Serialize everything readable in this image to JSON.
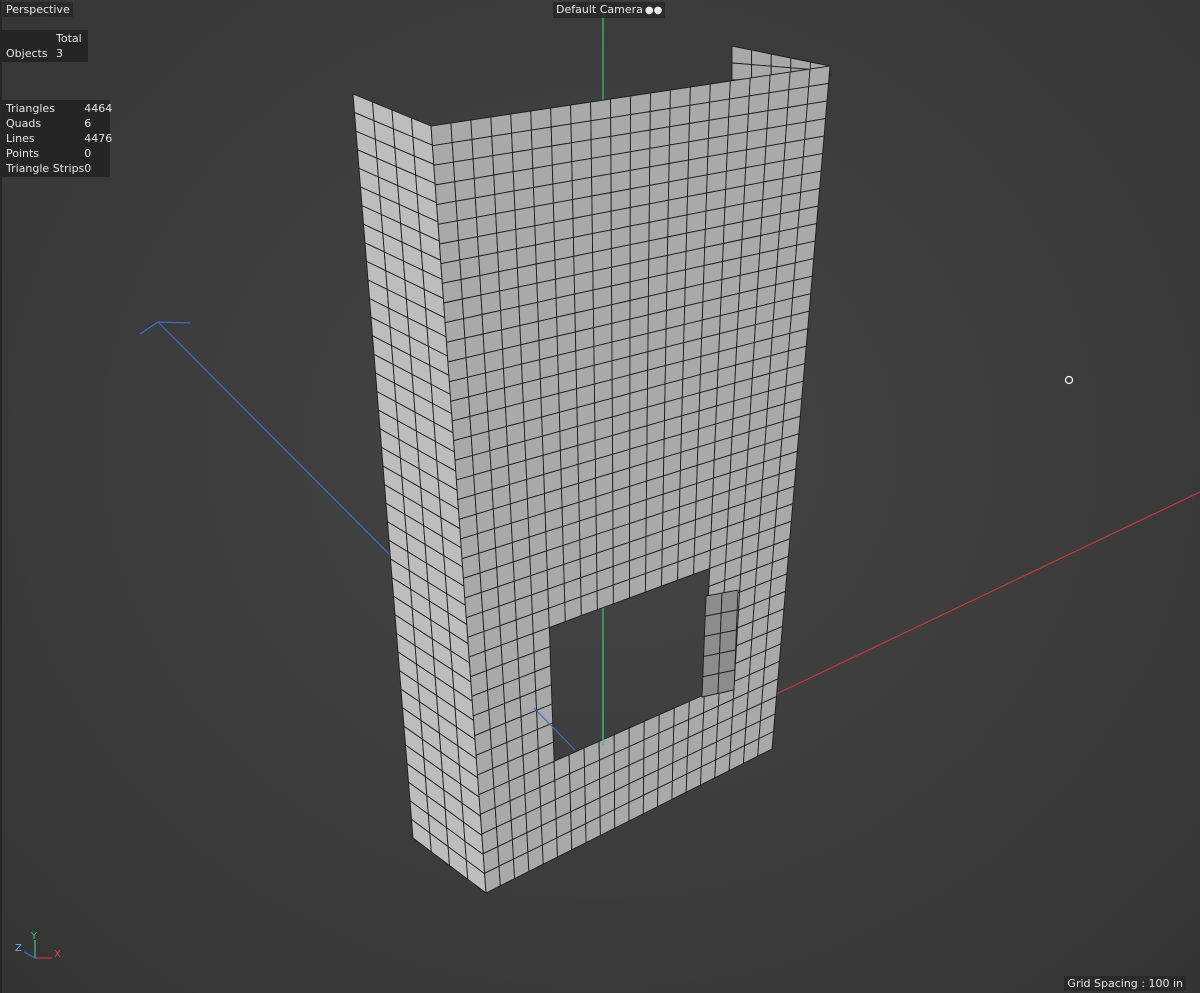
{
  "viewport": {
    "view_name": "Perspective",
    "camera_name": "Default Camera",
    "camera_icon": "camera-icon",
    "grid_spacing": "Grid Spacing : 100 in"
  },
  "stats_objects": {
    "header": "Total",
    "rows": [
      {
        "label": "Objects",
        "value": "3"
      }
    ]
  },
  "stats_geometry": {
    "rows": [
      {
        "label": "Triangles",
        "value": "4464"
      },
      {
        "label": "Quads",
        "value": "6"
      },
      {
        "label": "Lines",
        "value": "4476"
      },
      {
        "label": "Points",
        "value": "0"
      },
      {
        "label": "Triangle Strips",
        "value": "0"
      }
    ]
  },
  "axis_gizmo": {
    "y_label": "Y",
    "z_label": "Z",
    "x_label": "X"
  },
  "colors": {
    "background": "#3c3c3c",
    "axis_y": "#3fbf7f",
    "axis_x": "#c0393b",
    "axis_z": "#3a6fc4",
    "mesh_fill": "#9a9a9a",
    "mesh_line": "#1e1e1e"
  }
}
